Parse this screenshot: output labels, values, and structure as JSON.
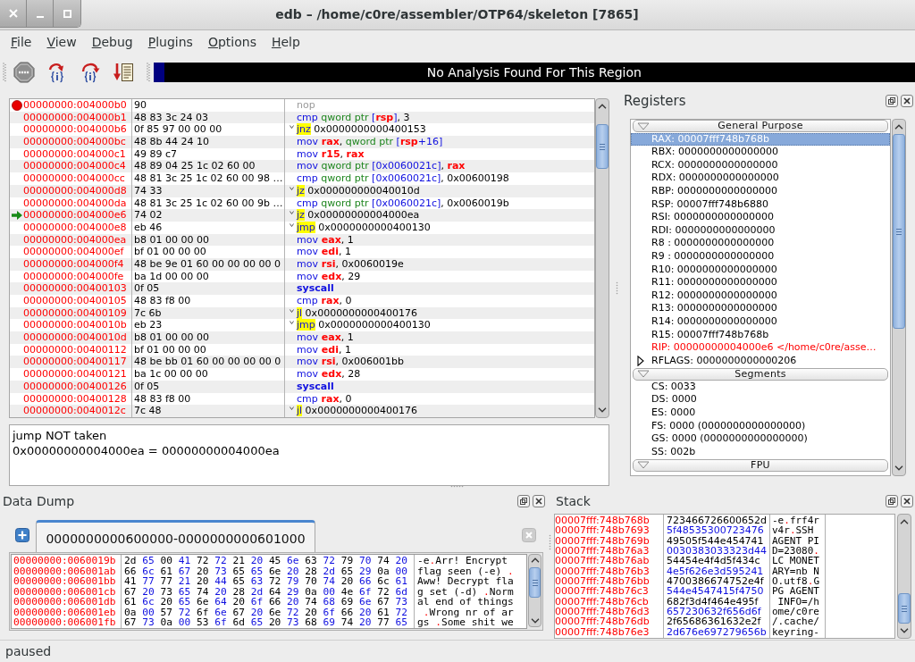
{
  "window": {
    "title": "edb – /home/c0re/assembler/OTP64/skeleton [7865]"
  },
  "menu": [
    "File",
    "View",
    "Debug",
    "Plugins",
    "Options",
    "Help"
  ],
  "analysis_bar": {
    "text": "No Analysis Found For This Region"
  },
  "disassembly": {
    "rows": [
      {
        "address": "00000000:004000b0",
        "bytes": "90",
        "breakpoint": true,
        "current": false,
        "instruction": [
          {
            "kind": "nop",
            "text": "nop"
          }
        ]
      },
      {
        "address": "00000000:004000b1",
        "bytes": "48 83 3c 24 03",
        "breakpoint": false,
        "current": false,
        "instruction": [
          {
            "kind": "mnemonic",
            "text": "cmp"
          },
          {
            "kind": "size",
            "text": " qword ptr"
          },
          {
            "kind": "memory",
            "text": " ["
          },
          {
            "kind": "register",
            "text": "rsp"
          },
          {
            "kind": "memory",
            "text": "]"
          },
          {
            "kind": "plain",
            "text": ", 3"
          }
        ]
      },
      {
        "address": "00000000:004000b6",
        "bytes": "0f 85 97 00 00 00",
        "breakpoint": false,
        "current": false,
        "instruction": [
          {
            "kind": "jump",
            "text": "jnz"
          },
          {
            "kind": "plain",
            "text": " 0x0000000000400153"
          }
        ]
      },
      {
        "address": "00000000:004000bc",
        "bytes": "48 8b 44 24 10",
        "breakpoint": false,
        "current": false,
        "instruction": [
          {
            "kind": "mnemonic",
            "text": "mov"
          },
          {
            "kind": "register",
            "text": " rax"
          },
          {
            "kind": "plain",
            "text": ", "
          },
          {
            "kind": "size",
            "text": "qword ptr"
          },
          {
            "kind": "memory",
            "text": " ["
          },
          {
            "kind": "register",
            "text": "rsp"
          },
          {
            "kind": "memory",
            "text": "+16]"
          }
        ]
      },
      {
        "address": "00000000:004000c1",
        "bytes": "49 89 c7",
        "breakpoint": false,
        "current": false,
        "instruction": [
          {
            "kind": "mnemonic",
            "text": "mov"
          },
          {
            "kind": "register",
            "text": " r15"
          },
          {
            "kind": "plain",
            "text": ", "
          },
          {
            "kind": "register",
            "text": "rax"
          }
        ]
      },
      {
        "address": "00000000:004000c4",
        "bytes": "48 89 04 25 1c 02 60 00",
        "breakpoint": false,
        "current": false,
        "instruction": [
          {
            "kind": "mnemonic",
            "text": "mov"
          },
          {
            "kind": "size",
            "text": " qword ptr"
          },
          {
            "kind": "memory",
            "text": " [0x0060021c]"
          },
          {
            "kind": "plain",
            "text": ", "
          },
          {
            "kind": "register",
            "text": "rax"
          }
        ]
      },
      {
        "address": "00000000:004000cc",
        "bytes": "48 81 3c 25 1c 02 60 00 98 …",
        "breakpoint": false,
        "current": false,
        "instruction": [
          {
            "kind": "mnemonic",
            "text": "cmp"
          },
          {
            "kind": "size",
            "text": " qword ptr"
          },
          {
            "kind": "memory",
            "text": " [0x0060021c]"
          },
          {
            "kind": "plain",
            "text": ", 0x00600198"
          }
        ]
      },
      {
        "address": "00000000:004000d8",
        "bytes": "74 33",
        "breakpoint": false,
        "current": false,
        "instruction": [
          {
            "kind": "jump",
            "text": "jz"
          },
          {
            "kind": "plain",
            "text": " 0x000000000040010d"
          }
        ]
      },
      {
        "address": "00000000:004000da",
        "bytes": "48 81 3c 25 1c 02 60 00 9b …",
        "breakpoint": false,
        "current": false,
        "instruction": [
          {
            "kind": "mnemonic",
            "text": "cmp"
          },
          {
            "kind": "size",
            "text": " qword ptr"
          },
          {
            "kind": "memory",
            "text": " [0x0060021c]"
          },
          {
            "kind": "plain",
            "text": ", 0x0060019b"
          }
        ]
      },
      {
        "address": "00000000:004000e6",
        "bytes": "74 02",
        "breakpoint": false,
        "current": true,
        "instruction": [
          {
            "kind": "jump",
            "text": "jz"
          },
          {
            "kind": "plain",
            "text": " 0x00000000004000ea"
          }
        ]
      },
      {
        "address": "00000000:004000e8",
        "bytes": "eb 46",
        "breakpoint": false,
        "current": false,
        "instruction": [
          {
            "kind": "jump",
            "text": "jmp"
          },
          {
            "kind": "plain",
            "text": " 0x0000000000400130"
          }
        ]
      },
      {
        "address": "00000000:004000ea",
        "bytes": "b8 01 00 00 00",
        "breakpoint": false,
        "current": false,
        "instruction": [
          {
            "kind": "mnemonic",
            "text": "mov"
          },
          {
            "kind": "register",
            "text": " eax"
          },
          {
            "kind": "plain",
            "text": ", 1"
          }
        ]
      },
      {
        "address": "00000000:004000ef",
        "bytes": "bf 01 00 00 00",
        "breakpoint": false,
        "current": false,
        "instruction": [
          {
            "kind": "mnemonic",
            "text": "mov"
          },
          {
            "kind": "register",
            "text": " edi"
          },
          {
            "kind": "plain",
            "text": ", 1"
          }
        ]
      },
      {
        "address": "00000000:004000f4",
        "bytes": "48 be 9e 01 60 00 00 00 00 0",
        "breakpoint": false,
        "current": false,
        "instruction": [
          {
            "kind": "mnemonic",
            "text": "mov"
          },
          {
            "kind": "register",
            "text": " rsi"
          },
          {
            "kind": "plain",
            "text": ", 0x0060019e"
          }
        ]
      },
      {
        "address": "00000000:004000fe",
        "bytes": "ba 1d 00 00 00",
        "breakpoint": false,
        "current": false,
        "instruction": [
          {
            "kind": "mnemonic",
            "text": "mov"
          },
          {
            "kind": "register",
            "text": " edx"
          },
          {
            "kind": "plain",
            "text": ", 29"
          }
        ]
      },
      {
        "address": "00000000:00400103",
        "bytes": "0f 05",
        "breakpoint": false,
        "current": false,
        "instruction": [
          {
            "kind": "system",
            "text": "syscall"
          }
        ]
      },
      {
        "address": "00000000:00400105",
        "bytes": "48 83 f8 00",
        "breakpoint": false,
        "current": false,
        "instruction": [
          {
            "kind": "mnemonic",
            "text": "cmp"
          },
          {
            "kind": "register",
            "text": " rax"
          },
          {
            "kind": "plain",
            "text": ", 0"
          }
        ]
      },
      {
        "address": "00000000:00400109",
        "bytes": "7c 6b",
        "breakpoint": false,
        "current": false,
        "instruction": [
          {
            "kind": "jump",
            "text": "jl"
          },
          {
            "kind": "plain",
            "text": " 0x0000000000400176"
          }
        ]
      },
      {
        "address": "00000000:0040010b",
        "bytes": "eb 23",
        "breakpoint": false,
        "current": false,
        "instruction": [
          {
            "kind": "jump",
            "text": "jmp"
          },
          {
            "kind": "plain",
            "text": " 0x0000000000400130"
          }
        ]
      },
      {
        "address": "00000000:0040010d",
        "bytes": "b8 01 00 00 00",
        "breakpoint": false,
        "current": false,
        "instruction": [
          {
            "kind": "mnemonic",
            "text": "mov"
          },
          {
            "kind": "register",
            "text": " eax"
          },
          {
            "kind": "plain",
            "text": ", 1"
          }
        ]
      },
      {
        "address": "00000000:00400112",
        "bytes": "bf 01 00 00 00",
        "breakpoint": false,
        "current": false,
        "instruction": [
          {
            "kind": "mnemonic",
            "text": "mov"
          },
          {
            "kind": "register",
            "text": " edi"
          },
          {
            "kind": "plain",
            "text": ", 1"
          }
        ]
      },
      {
        "address": "00000000:00400117",
        "bytes": "48 be bb 01 60 00 00 00 00 0",
        "breakpoint": false,
        "current": false,
        "instruction": [
          {
            "kind": "mnemonic",
            "text": "mov"
          },
          {
            "kind": "register",
            "text": " rsi"
          },
          {
            "kind": "plain",
            "text": ", 0x006001bb"
          }
        ]
      },
      {
        "address": "00000000:00400121",
        "bytes": "ba 1c 00 00 00",
        "breakpoint": false,
        "current": false,
        "instruction": [
          {
            "kind": "mnemonic",
            "text": "mov"
          },
          {
            "kind": "register",
            "text": " edx"
          },
          {
            "kind": "plain",
            "text": ", 28"
          }
        ]
      },
      {
        "address": "00000000:00400126",
        "bytes": "0f 05",
        "breakpoint": false,
        "current": false,
        "instruction": [
          {
            "kind": "system",
            "text": "syscall"
          }
        ]
      },
      {
        "address": "00000000:00400128",
        "bytes": "48 83 f8 00",
        "breakpoint": false,
        "current": false,
        "instruction": [
          {
            "kind": "mnemonic",
            "text": "cmp"
          },
          {
            "kind": "register",
            "text": " rax"
          },
          {
            "kind": "plain",
            "text": ", 0"
          }
        ]
      },
      {
        "address": "00000000:0040012c",
        "bytes": "7c 48",
        "breakpoint": false,
        "current": false,
        "instruction": [
          {
            "kind": "jump",
            "text": "jl"
          },
          {
            "kind": "plain",
            "text": " 0x0000000000400176"
          }
        ]
      }
    ]
  },
  "output": {
    "lines": [
      "jump NOT taken",
      "0x00000000004000ea = 00000000004000ea"
    ]
  },
  "registers": {
    "title": "Registers",
    "groups": [
      {
        "title": "General Purpose",
        "expanded": true,
        "registers": [
          {
            "kind": "value",
            "text": "RAX: 00007fff748b768b",
            "selected": true,
            "changed": false
          },
          {
            "kind": "value",
            "text": "RBX: 0000000000000000",
            "selected": false,
            "changed": false
          },
          {
            "kind": "value",
            "text": "RCX: 0000000000000000",
            "selected": false,
            "changed": false
          },
          {
            "kind": "value",
            "text": "RDX: 0000000000000000",
            "selected": false,
            "changed": false
          },
          {
            "kind": "value",
            "text": "RBP: 0000000000000000",
            "selected": false,
            "changed": false
          },
          {
            "kind": "value",
            "text": "RSP: 00007fff748b6880",
            "selected": false,
            "changed": false
          },
          {
            "kind": "value",
            "text": "RSI: 0000000000000000",
            "selected": false,
            "changed": false
          },
          {
            "kind": "value",
            "text": "RDI: 0000000000000000",
            "selected": false,
            "changed": false
          },
          {
            "kind": "value",
            "text": "R8 : 0000000000000000",
            "selected": false,
            "changed": false
          },
          {
            "kind": "value",
            "text": "R9 : 0000000000000000",
            "selected": false,
            "changed": false
          },
          {
            "kind": "value",
            "text": "R10: 0000000000000000",
            "selected": false,
            "changed": false
          },
          {
            "kind": "value",
            "text": "R11: 0000000000000000",
            "selected": false,
            "changed": false
          },
          {
            "kind": "value",
            "text": "R12: 0000000000000000",
            "selected": false,
            "changed": false
          },
          {
            "kind": "value",
            "text": "R13: 0000000000000000",
            "selected": false,
            "changed": false
          },
          {
            "kind": "value",
            "text": "R14: 0000000000000000",
            "selected": false,
            "changed": false
          },
          {
            "kind": "value",
            "text": "R15: 00007fff748b768b",
            "selected": false,
            "changed": false
          },
          {
            "kind": "value",
            "text": "RIP: 00000000004000e6 </home/c0re/asse…",
            "selected": false,
            "changed": true
          },
          {
            "kind": "expandable",
            "text": "RFLAGS: 0000000000000206",
            "selected": false,
            "changed": false,
            "expanded": false
          }
        ]
      },
      {
        "title": "Segments",
        "expanded": true,
        "registers": [
          {
            "kind": "value",
            "text": "CS: 0033",
            "selected": false,
            "changed": false
          },
          {
            "kind": "value",
            "text": "DS: 0000",
            "selected": false,
            "changed": false
          },
          {
            "kind": "value",
            "text": "ES: 0000",
            "selected": false,
            "changed": false
          },
          {
            "kind": "value",
            "text": "FS: 0000 (0000000000000000)",
            "selected": false,
            "changed": false
          },
          {
            "kind": "value",
            "text": "GS: 0000 (0000000000000000)",
            "selected": false,
            "changed": false
          },
          {
            "kind": "value",
            "text": "SS: 002b",
            "selected": false,
            "changed": false
          }
        ]
      },
      {
        "title": "FPU",
        "expanded": true
      }
    ]
  },
  "data_dump": {
    "title": "Data Dump",
    "tabs": [
      {
        "label": "0000000000600000-0000000000601000",
        "selected": true
      }
    ],
    "rows": [
      {
        "address": "00000000:0060019b",
        "bytes": [
          "2d",
          "65",
          "00",
          "41",
          "72",
          "72",
          "21",
          "20",
          "45",
          "6e",
          "63",
          "72",
          "79",
          "70",
          "74",
          "20"
        ],
        "ascii": [
          {
            "kind": "text",
            "text": "-e"
          },
          {
            "kind": "unprintable",
            "text": "."
          },
          {
            "kind": "text",
            "text": "Arr! Encrypt"
          }
        ]
      },
      {
        "address": "00000000:006001ab",
        "bytes": [
          "66",
          "6c",
          "61",
          "67",
          "20",
          "73",
          "65",
          "65",
          "6e",
          "20",
          "28",
          "2d",
          "65",
          "29",
          "0a",
          "00"
        ],
        "ascii": [
          {
            "kind": "text",
            "text": "flag seen (-e)"
          },
          {
            "kind": "unprintable",
            "text": " ."
          }
        ]
      },
      {
        "address": "00000000:006001bb",
        "bytes": [
          "41",
          "77",
          "77",
          "21",
          "20",
          "44",
          "65",
          "63",
          "72",
          "79",
          "70",
          "74",
          "20",
          "66",
          "6c",
          "61"
        ],
        "ascii": [
          {
            "kind": "text",
            "text": "Aww! Decrypt fla"
          }
        ]
      },
      {
        "address": "00000000:006001cb",
        "bytes": [
          "67",
          "20",
          "73",
          "65",
          "74",
          "20",
          "28",
          "2d",
          "64",
          "29",
          "0a",
          "00",
          "4e",
          "6f",
          "72",
          "6d"
        ],
        "ascii": [
          {
            "kind": "text",
            "text": "g set (-d)"
          },
          {
            "kind": "unprintable",
            "text": " ."
          },
          {
            "kind": "text",
            "text": "Norm"
          }
        ]
      },
      {
        "address": "00000000:006001db",
        "bytes": [
          "61",
          "6c",
          "20",
          "65",
          "6e",
          "64",
          "20",
          "6f",
          "66",
          "20",
          "74",
          "68",
          "69",
          "6e",
          "67",
          "73"
        ],
        "ascii": [
          {
            "kind": "text",
            "text": "al end of things"
          }
        ]
      },
      {
        "address": "00000000:006001eb",
        "bytes": [
          "0a",
          "00",
          "57",
          "72",
          "6f",
          "6e",
          "67",
          "20",
          "6e",
          "72",
          "20",
          "6f",
          "66",
          "20",
          "61",
          "72"
        ],
        "ascii": [
          {
            "kind": "unprintable",
            "text": " ."
          },
          {
            "kind": "text",
            "text": "Wrong nr of ar"
          }
        ]
      },
      {
        "address": "00000000:006001fb",
        "bytes": [
          "67",
          "73",
          "0a",
          "00",
          "53",
          "6f",
          "6d",
          "65",
          "20",
          "73",
          "68",
          "69",
          "74",
          "20",
          "77",
          "65"
        ],
        "ascii": [
          {
            "kind": "text",
            "text": "gs"
          },
          {
            "kind": "unprintable",
            "text": " ."
          },
          {
            "kind": "text",
            "text": "Some shit we"
          }
        ]
      }
    ]
  },
  "stack": {
    "title": "Stack",
    "rows": [
      {
        "address": "00007fff:748b768b",
        "value": "723466726600652d",
        "ascii": [
          {
            "kind": "text",
            "text": "-e"
          },
          {
            "kind": "unprintable",
            "text": "."
          },
          {
            "kind": "text",
            "text": "frf4r"
          }
        ]
      },
      {
        "address": "00007fff:748b7693",
        "value": "5f48535300723476",
        "ascii": [
          {
            "kind": "text",
            "text": "v4r"
          },
          {
            "kind": "unprintable",
            "text": "."
          },
          {
            "kind": "text",
            "text": "SSH"
          }
        ]
      },
      {
        "address": "00007fff:748b769b",
        "value": "49505f544e454741",
        "ascii": [
          {
            "kind": "text",
            "text": "AGENT PI"
          }
        ]
      },
      {
        "address": "00007fff:748b76a3",
        "value": "0030383033323d44",
        "ascii": [
          {
            "kind": "text",
            "text": "D=23080"
          },
          {
            "kind": "unprintable",
            "text": "."
          }
        ]
      },
      {
        "address": "00007fff:748b76ab",
        "value": "54454e4f4d5f434c",
        "ascii": [
          {
            "kind": "text",
            "text": "LC MONET"
          }
        ]
      },
      {
        "address": "00007fff:748b76b3",
        "value": "4e5f626e3d595241",
        "ascii": [
          {
            "kind": "text",
            "text": "ARY=nb N"
          }
        ]
      },
      {
        "address": "00007fff:748b76bb",
        "value": "4700386674752e4f",
        "ascii": [
          {
            "kind": "text",
            "text": "O.utf8"
          },
          {
            "kind": "unprintable",
            "text": "."
          },
          {
            "kind": "text",
            "text": "G"
          }
        ]
      },
      {
        "address": "00007fff:748b76c3",
        "value": "544e4547415f4750",
        "ascii": [
          {
            "kind": "text",
            "text": "PG AGENT"
          }
        ]
      },
      {
        "address": "00007fff:748b76cb",
        "value": "682f3d4f464e495f",
        "ascii": [
          {
            "kind": "text",
            "text": " INFO=/h"
          }
        ]
      },
      {
        "address": "00007fff:748b76d3",
        "value": "657230632f656d6f",
        "ascii": [
          {
            "kind": "text",
            "text": "ome/c0re"
          }
        ]
      },
      {
        "address": "00007fff:748b76db",
        "value": "2f65686361632e2f",
        "ascii": [
          {
            "kind": "text",
            "text": "/.cache/"
          }
        ]
      },
      {
        "address": "00007fff:748b76e3",
        "value": "2d676e697279656b",
        "ascii": [
          {
            "kind": "text",
            "text": "keyring-"
          }
        ]
      }
    ]
  },
  "status_bar": {
    "text": "paused"
  }
}
